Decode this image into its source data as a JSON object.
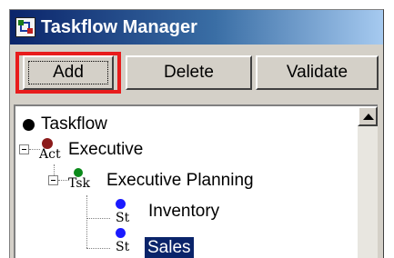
{
  "window": {
    "title": "Taskflow Manager"
  },
  "toolbar": {
    "add_label": "Add",
    "delete_label": "Delete",
    "validate_label": "Validate"
  },
  "tree": {
    "root": {
      "label": "Taskflow"
    },
    "activity": {
      "label": "Executive",
      "type_badge": "Act"
    },
    "task": {
      "label": "Executive Planning",
      "type_badge": "Tsk"
    },
    "steps": [
      {
        "label": "Inventory",
        "type_badge": "St",
        "selected": false
      },
      {
        "label": "Sales",
        "type_badge": "St",
        "selected": true
      }
    ]
  },
  "colors": {
    "highlight_outline": "#e81c1c",
    "selection": "#0a246a",
    "activity_dot": "#8b1a1a",
    "task_dot": "#0a8a1a",
    "step_dot": "#1a1aff"
  }
}
